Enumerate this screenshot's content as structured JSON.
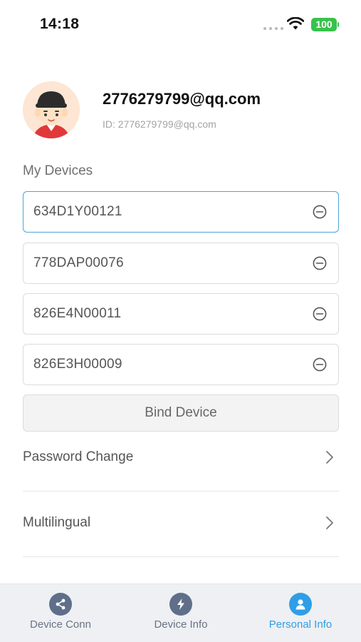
{
  "status_bar": {
    "time": "14:18",
    "battery": "100"
  },
  "profile": {
    "name": "2776279799@qq.com",
    "id_text": "ID: 2776279799@qq.com"
  },
  "devices": {
    "title": "My Devices",
    "items": [
      {
        "serial": "634D1Y00121",
        "selected": true
      },
      {
        "serial": "778DAP00076",
        "selected": false
      },
      {
        "serial": "826E4N00011",
        "selected": false
      },
      {
        "serial": "826E3H00009",
        "selected": false
      }
    ],
    "bind_label": "Bind Device"
  },
  "menu": [
    {
      "label": "Password Change"
    },
    {
      "label": "Multilingual"
    }
  ],
  "tabs": [
    {
      "label": "Device Conn",
      "icon": "share-icon",
      "active": false
    },
    {
      "label": "Device Info",
      "icon": "lightning-icon",
      "active": false
    },
    {
      "label": "Personal Info",
      "icon": "person-icon",
      "active": true
    }
  ],
  "colors": {
    "accent": "#2f9ee6",
    "battery": "#37c24b",
    "tab_icon": "#5f6f8a"
  }
}
